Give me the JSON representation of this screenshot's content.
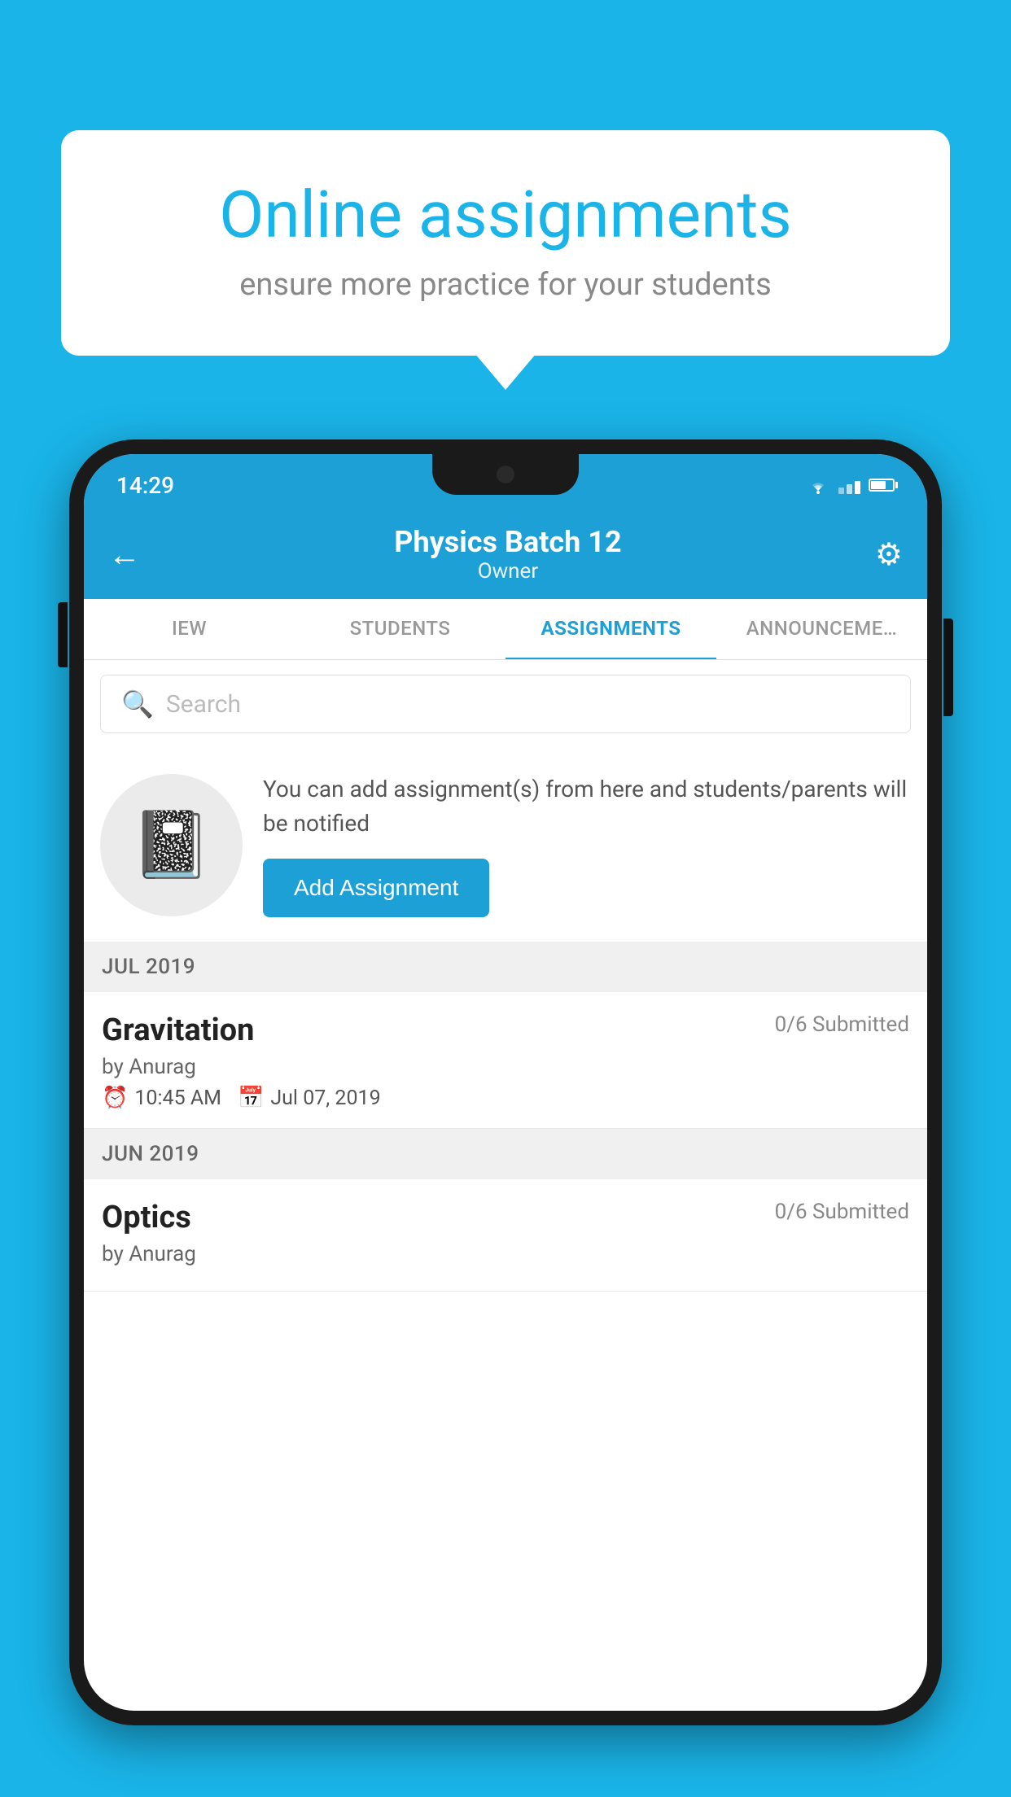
{
  "background_color": "#1ab4e8",
  "speech_bubble": {
    "title": "Online assignments",
    "subtitle": "ensure more practice for your students"
  },
  "status_bar": {
    "time": "14:29",
    "wifi": "▾",
    "battery_percent": 70
  },
  "app_header": {
    "title": "Physics Batch 12",
    "subtitle": "Owner",
    "back_label": "←",
    "settings_label": "⚙"
  },
  "tabs": [
    {
      "label": "IEW",
      "active": false
    },
    {
      "label": "STUDENTS",
      "active": false
    },
    {
      "label": "ASSIGNMENTS",
      "active": true
    },
    {
      "label": "ANNOUNCEMENTS",
      "active": false
    }
  ],
  "search": {
    "placeholder": "Search"
  },
  "promo": {
    "description": "You can add assignment(s) from here and students/parents will be notified",
    "button_label": "Add Assignment"
  },
  "sections": [
    {
      "label": "JUL 2019",
      "assignments": [
        {
          "title": "Gravitation",
          "submitted": "0/6 Submitted",
          "by": "by Anurag",
          "time": "10:45 AM",
          "date": "Jul 07, 2019"
        }
      ]
    },
    {
      "label": "JUN 2019",
      "assignments": [
        {
          "title": "Optics",
          "submitted": "0/6 Submitted",
          "by": "by Anurag",
          "time": "",
          "date": ""
        }
      ]
    }
  ]
}
